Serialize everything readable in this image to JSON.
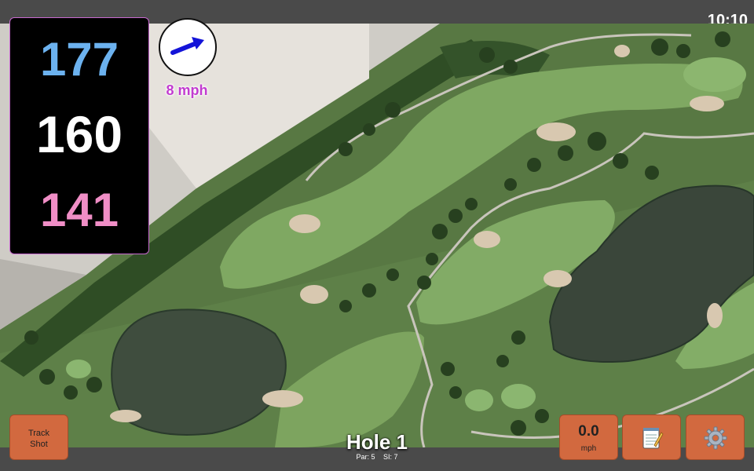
{
  "status_bar": {
    "time": "10:10"
  },
  "distances": {
    "back": "177",
    "middle": "160",
    "front": "141"
  },
  "wind": {
    "speed": "8 mph",
    "icon": "wind-direction-arrow-icon"
  },
  "hole": {
    "title": "Hole 1",
    "par": "Par: 5",
    "si": "SI: 7"
  },
  "buttons": {
    "track_shot_line1": "Track",
    "track_shot_line2": "Shot",
    "speed_value": "0.0",
    "speed_unit": "mph",
    "notes_icon": "notepad-icon",
    "settings_icon": "gear-icon"
  },
  "colors": {
    "back_distance": "#6cb2ef",
    "middle_distance": "#ffffff",
    "front_distance": "#f08ec6",
    "wind_text": "#c23bd0",
    "button_bg": "#d2693f"
  }
}
